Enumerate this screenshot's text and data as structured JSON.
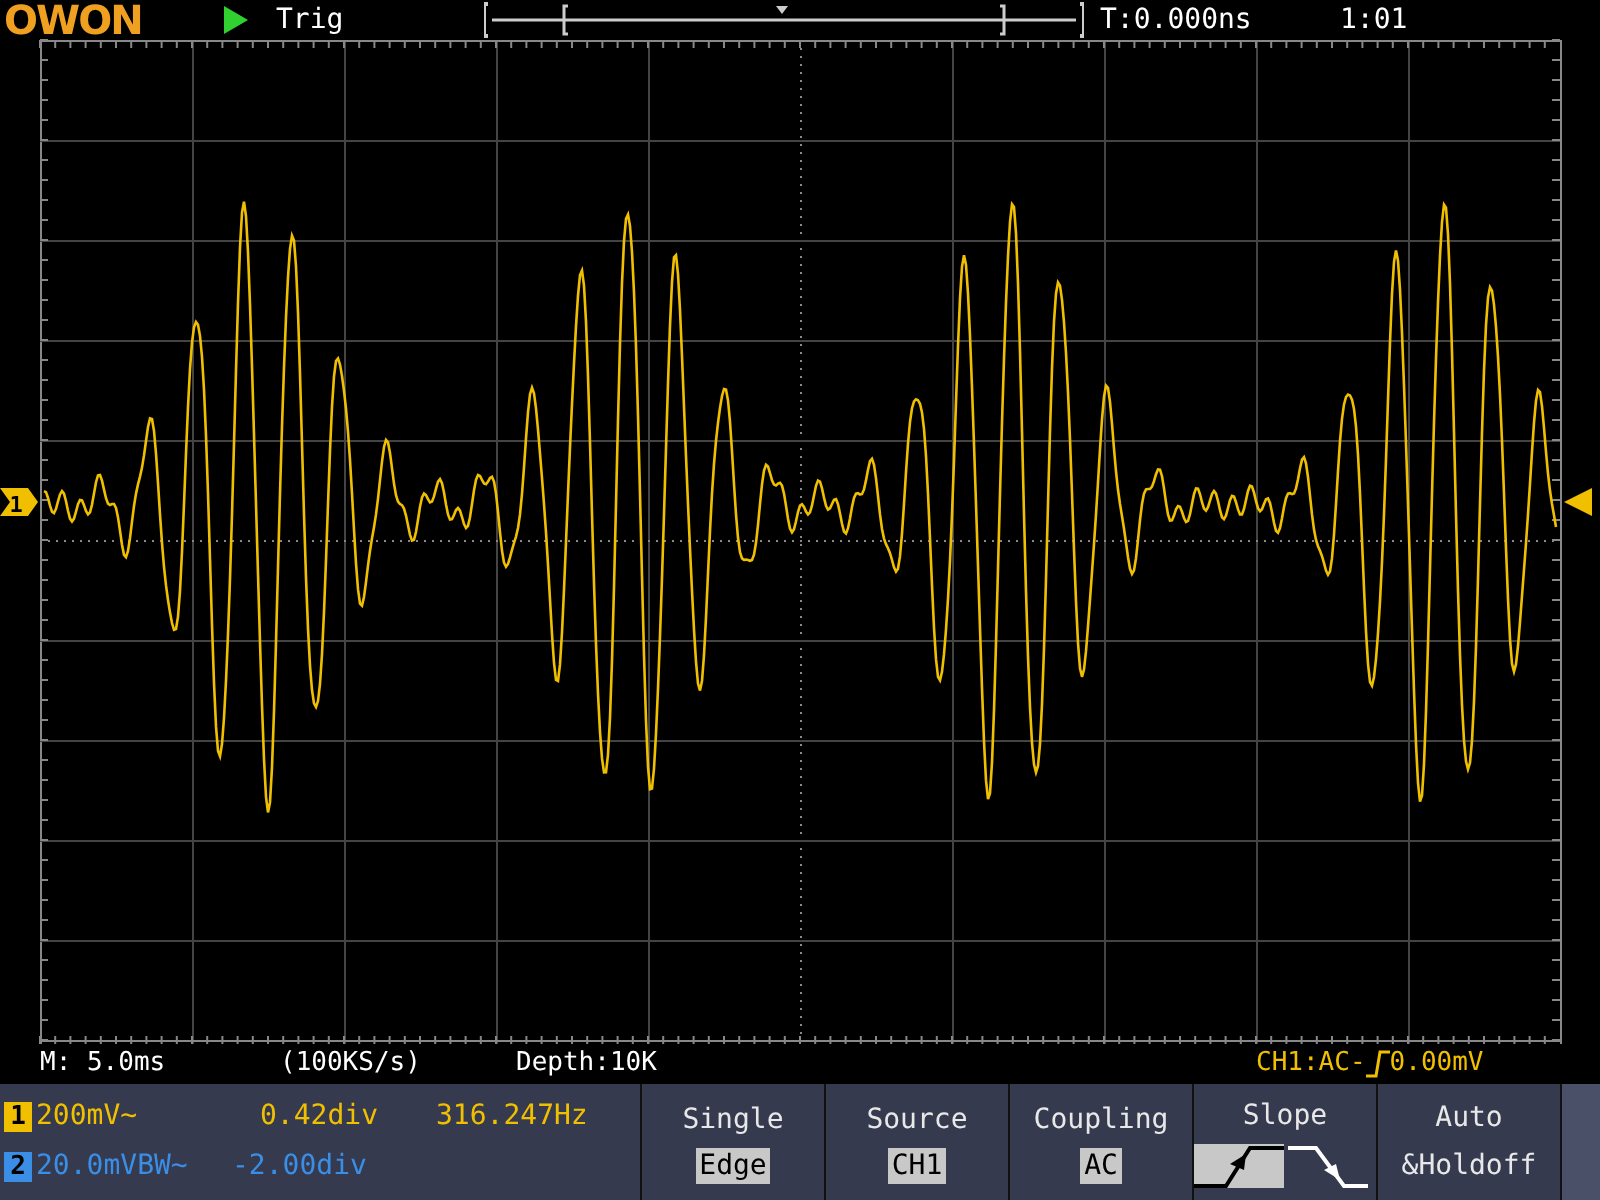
{
  "top_bar": {
    "brand": "OWON",
    "running": true,
    "trigger_status": "Trig",
    "trigger_time": "T:0.000ns",
    "time": "1:01"
  },
  "scope": {
    "channel_marker": "1"
  },
  "info_line": {
    "timebase": "M: 5.0ms",
    "sample_rate": "(100KS/s)",
    "depth": "Depth:10K",
    "trigger_info": "CH1:AC-",
    "trigger_level": "0.00mV"
  },
  "channels": [
    {
      "marker": "1",
      "color": "#f0c000",
      "scale": "200mV~",
      "position": "0.42div",
      "frequency": "316.247Hz"
    },
    {
      "marker": "2",
      "color": "#3a8ee6",
      "scale": "20.0mVBW~",
      "position": "-2.00div"
    }
  ],
  "menu": [
    {
      "kind": "value",
      "title": "Single",
      "value": "Edge"
    },
    {
      "kind": "value",
      "title": "Source",
      "value": "CH1"
    },
    {
      "kind": "value",
      "title": "Coupling",
      "value": "AC"
    },
    {
      "kind": "slope",
      "title": "Slope",
      "options": [
        {
          "kind": "rising",
          "selected": true
        },
        {
          "kind": "falling",
          "selected": false
        }
      ]
    },
    {
      "kind": "text",
      "title": "Auto",
      "subtitle": "&Holdoff"
    }
  ]
}
